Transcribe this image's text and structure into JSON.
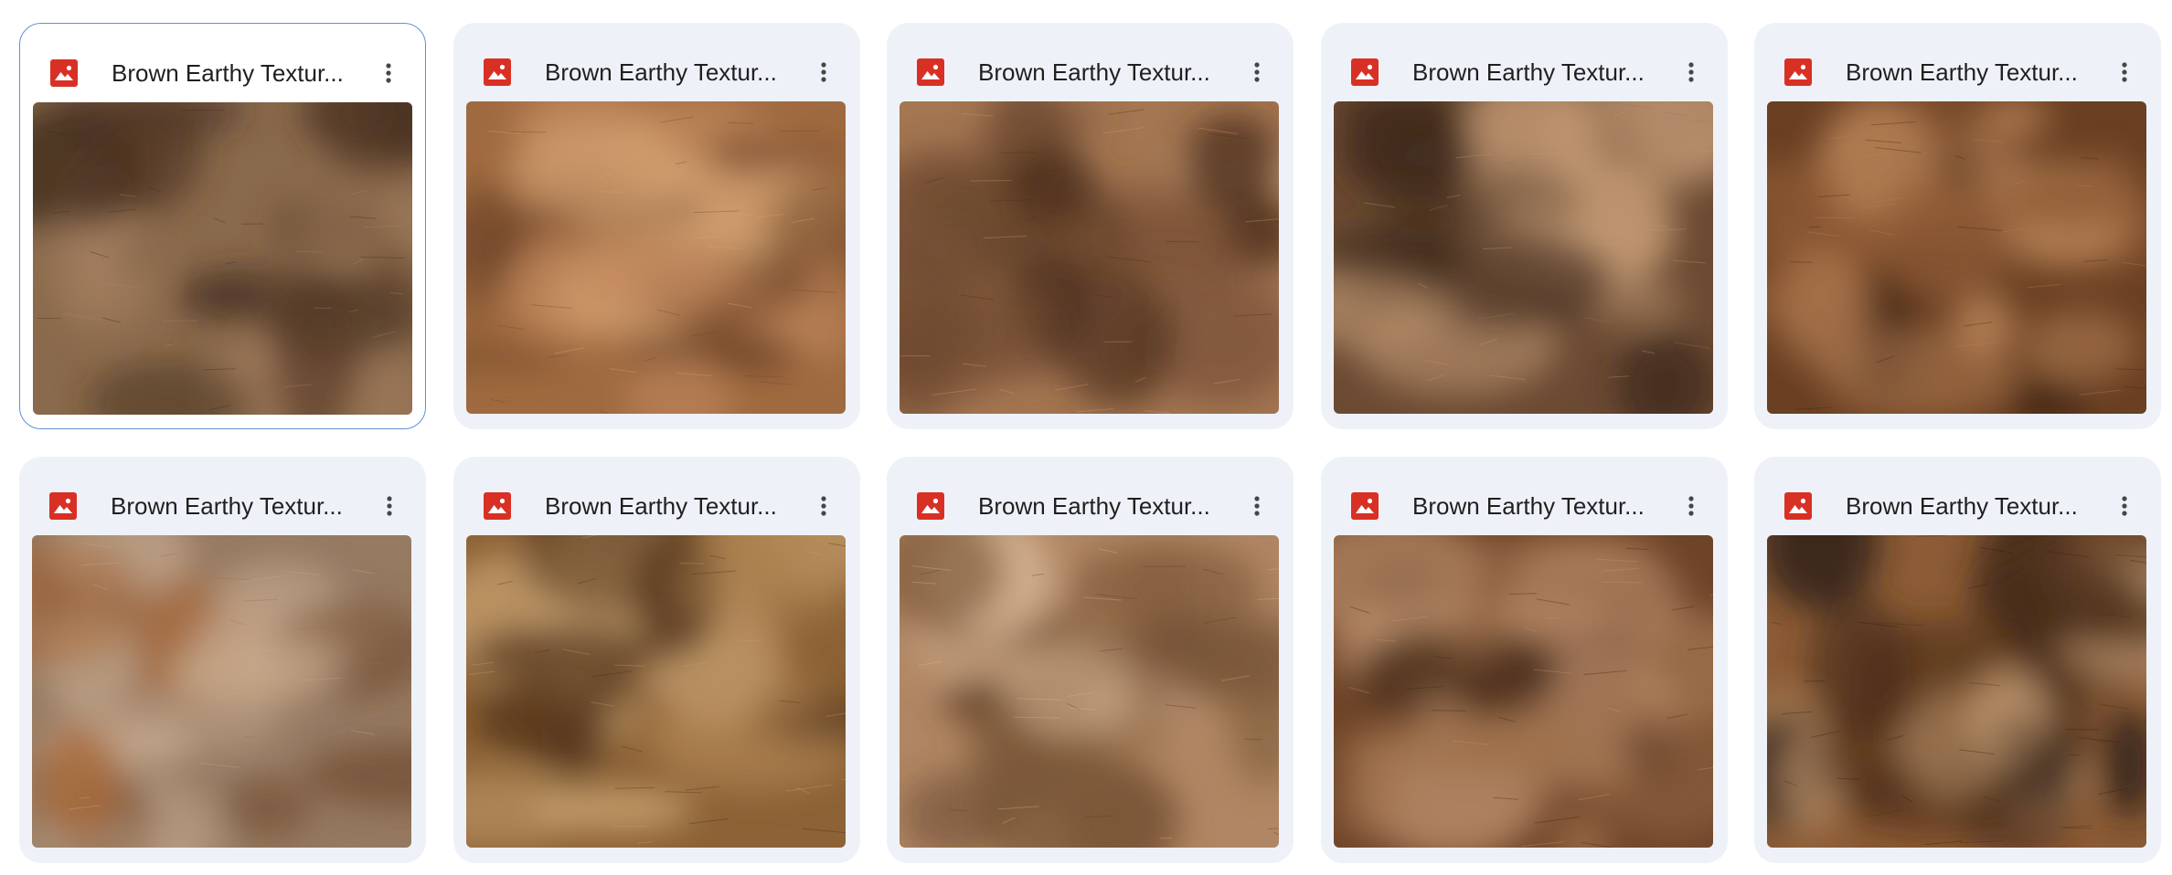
{
  "files": [
    {
      "name": "Brown Earthy Textur...",
      "selected": true,
      "palette": [
        "#8a6a4c",
        "#5a3d28",
        "#b08868",
        "#3f2a1c"
      ]
    },
    {
      "name": "Brown Earthy Textur...",
      "selected": false,
      "palette": [
        "#a06a40",
        "#c48a5e",
        "#6e4428",
        "#d9a878"
      ]
    },
    {
      "name": "Brown Earthy Textur...",
      "selected": false,
      "palette": [
        "#a47652",
        "#6f4930",
        "#cfa078",
        "#4a2e1c"
      ]
    },
    {
      "name": "Brown Earthy Textur...",
      "selected": false,
      "palette": [
        "#6b4a33",
        "#3d2819",
        "#9a7356",
        "#c49a74"
      ]
    },
    {
      "name": "Brown Earthy Textur...",
      "selected": false,
      "palette": [
        "#6a3f22",
        "#8e5a34",
        "#3e2314",
        "#b98458"
      ]
    },
    {
      "name": "Brown Earthy Textur...",
      "selected": false,
      "palette": [
        "#967a62",
        "#6e4a2c",
        "#c8ac92",
        "#a86a3a"
      ]
    },
    {
      "name": "Brown Earthy Textur...",
      "selected": false,
      "palette": [
        "#8c6236",
        "#b08452",
        "#4a2c16",
        "#c9a272"
      ]
    },
    {
      "name": "Brown Earthy Textur...",
      "selected": false,
      "palette": [
        "#b08664",
        "#7a5636",
        "#d9b896",
        "#5c3a22"
      ]
    },
    {
      "name": "Brown Earthy Textur...",
      "selected": false,
      "palette": [
        "#6e4428",
        "#a0724e",
        "#3e2414",
        "#c79a76"
      ]
    },
    {
      "name": "Brown Earthy Textur...",
      "selected": false,
      "palette": [
        "#8c5c36",
        "#c49a72",
        "#4a2c18",
        "#2e1e14"
      ]
    }
  ],
  "icons": {
    "file_type": "image-file-icon",
    "menu": "more-vert-icon",
    "file_icon_color": "#d93025"
  }
}
